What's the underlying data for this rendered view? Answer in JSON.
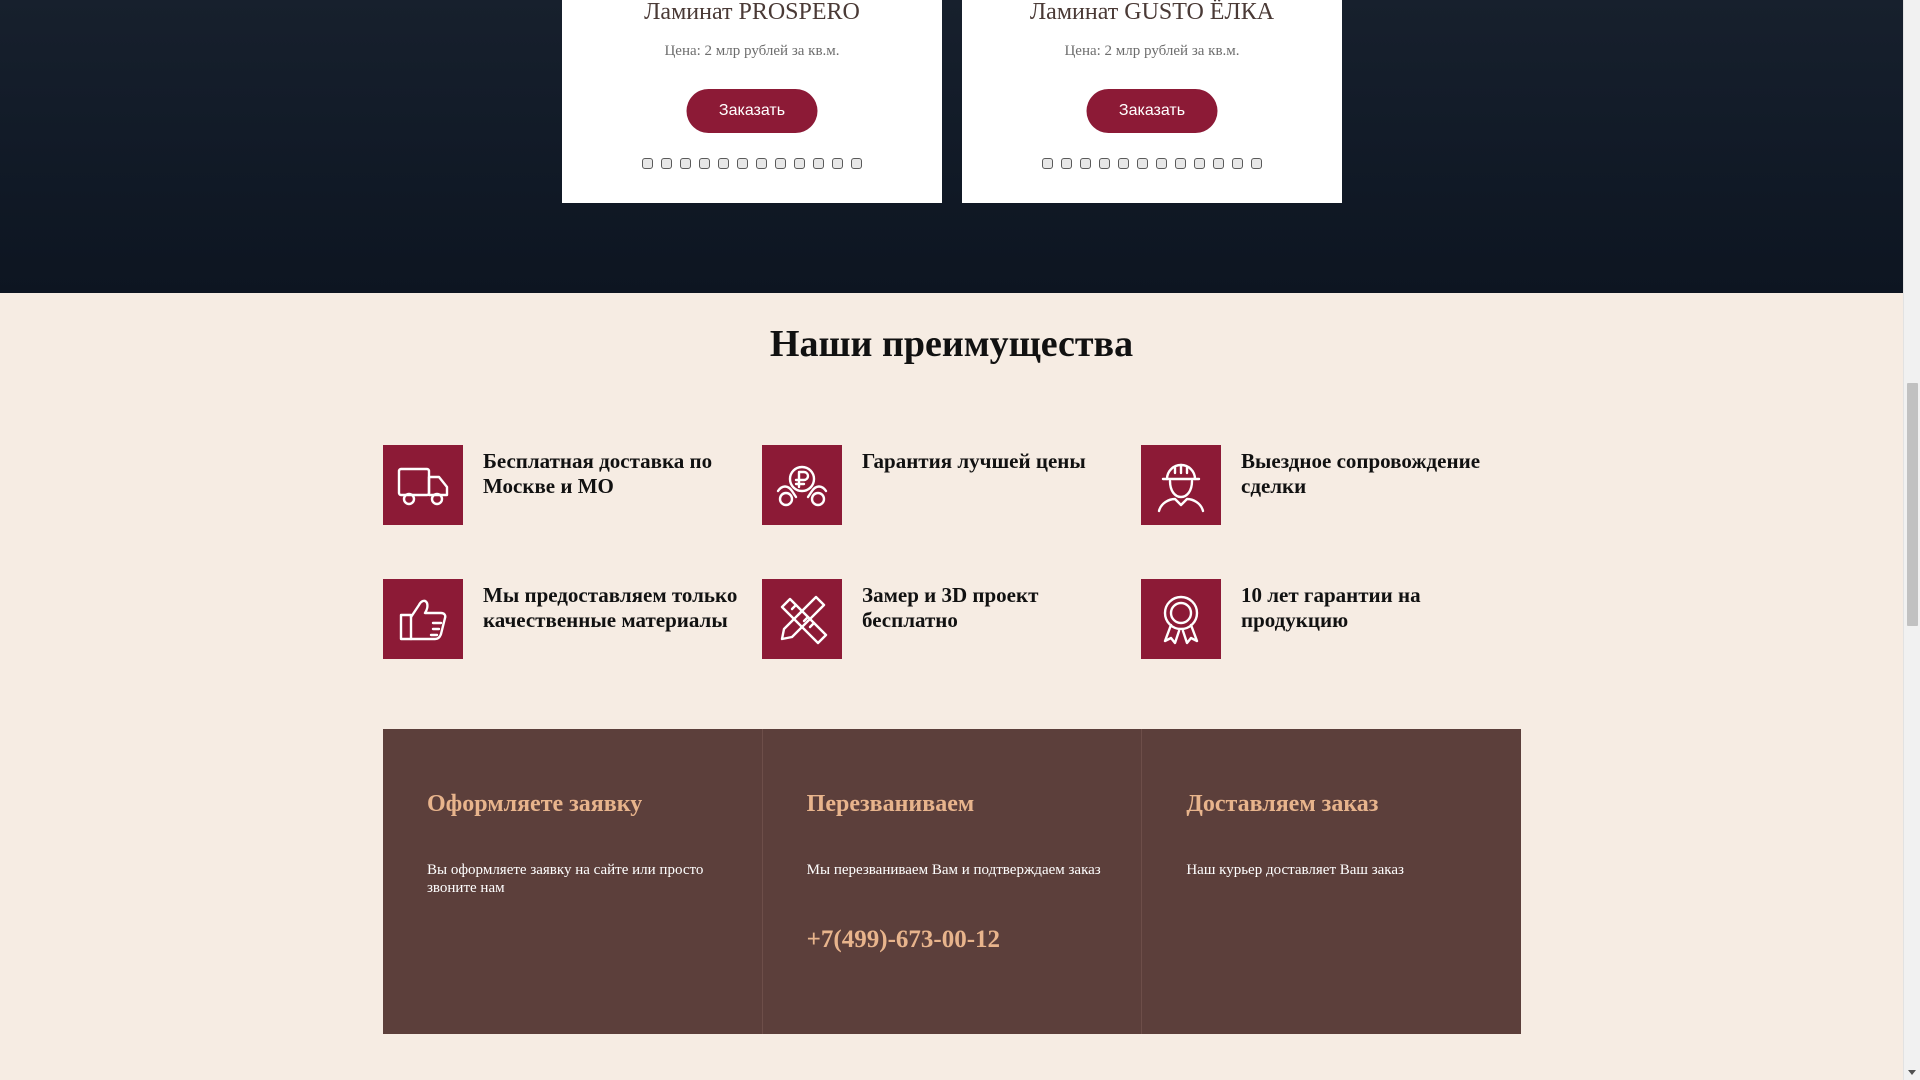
{
  "products": [
    {
      "title": "Ламинат PROSPERO",
      "price": "Цена: 2 млр рублей за кв.м.",
      "button": "Заказать",
      "dots": 12
    },
    {
      "title": "Ламинат GUSTO ЁЛКА",
      "price": "Цена: 2 млр рублей за кв.м.",
      "button": "Заказать",
      "dots": 12
    }
  ],
  "advantages": {
    "title": "Наши преимущества",
    "items": [
      {
        "icon": "truck-icon",
        "text": "Бесплатная доставка по Москве и МО"
      },
      {
        "icon": "ruble-hands-icon",
        "text": "Гарантия лучшей цены"
      },
      {
        "icon": "worker-helmet-icon",
        "text": "Выездное сопровождение сделки"
      },
      {
        "icon": "thumbs-up-icon",
        "text": "Мы предоставляем только качественные материалы"
      },
      {
        "icon": "ruler-pencil-icon",
        "text": "Замер и 3D проект бесплатно"
      },
      {
        "icon": "award-medal-icon",
        "text": "10 лет гарантии на продукцию"
      }
    ]
  },
  "steps": [
    {
      "title": "Оформляете заявку",
      "desc": "Вы оформляете заявку на сайте или просто звоните нам"
    },
    {
      "title": "Перезваниваем",
      "desc": "Мы перезваниваем Вам и подтверждаем заказ",
      "phone": "+7(499)-673-00-12"
    },
    {
      "title": "Доставляем заказ",
      "desc": "Наш курьер доставляет Ваш заказ"
    }
  ],
  "colors": {
    "accent": "#8c1a36",
    "hero_background": "#121b28",
    "page_background": "#f6ece3",
    "steps_background": "#5c3f3b",
    "steps_title": "#e8b48c"
  }
}
